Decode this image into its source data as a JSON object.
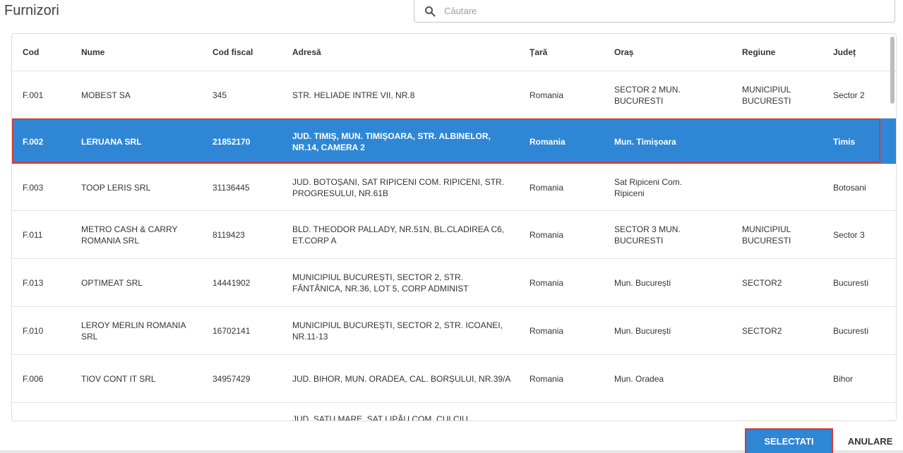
{
  "title": "Furnizori",
  "search": {
    "placeholder": "Căutare",
    "icon": "search-icon"
  },
  "columns": [
    "Cod",
    "Nume",
    "Cod fiscal",
    "Adresă",
    "Țară",
    "Oraș",
    "Regiune",
    "Județ"
  ],
  "rows": [
    {
      "cod": "F.001",
      "nume": "MOBEST SA",
      "cod_fiscal": "345",
      "adresa": "STR. HELIADE INTRE VII, NR.8",
      "tara": "Romania",
      "oras": "SECTOR 2 MUN. BUCURESTI",
      "regiune": "MUNICIPIUL BUCURESTI",
      "judet": "Sector 2",
      "selected": false
    },
    {
      "cod": "F.002",
      "nume": "LERUANA SRL",
      "cod_fiscal": "21852170",
      "adresa": "JUD. TIMIȘ, MUN. TIMIȘOARA, STR. ALBINELOR, NR.14, CAMERA 2",
      "tara": "Romania",
      "oras": "Mun. Timișoara",
      "regiune": "",
      "judet": "Timis",
      "selected": true
    },
    {
      "cod": "F.003",
      "nume": "TOOP LERIS SRL",
      "cod_fiscal": "31136445",
      "adresa": "JUD. BOTOȘANI, SAT RIPICENI COM. RIPICENI, STR. PROGRESULUI, NR.61B",
      "tara": "Romania",
      "oras": "Sat Ripiceni Com. Ripiceni",
      "regiune": "",
      "judet": "Botosani",
      "selected": false
    },
    {
      "cod": "F.011",
      "nume": "METRO CASH & CARRY ROMANIA SRL",
      "cod_fiscal": "8119423",
      "adresa": "BLD. THEODOR PALLADY, NR.51N, BL.CLADIREA C6, ET.CORP A",
      "tara": "Romania",
      "oras": "SECTOR 3 MUN. BUCURESTI",
      "regiune": "MUNICIPIUL BUCURESTI",
      "judet": "Sector 3",
      "selected": false
    },
    {
      "cod": "F.013",
      "nume": "OPTIMEAT SRL",
      "cod_fiscal": "14441902",
      "adresa": "MUNICIPIUL BUCUREȘTI, SECTOR 2, STR. FÂNTÂNICA, NR.36, LOT 5, CORP ADMINIST",
      "tara": "Romania",
      "oras": "Mun. București",
      "regiune": "SECTOR2",
      "judet": "Bucuresti",
      "selected": false
    },
    {
      "cod": "F.010",
      "nume": "LEROY MERLIN ROMANIA SRL",
      "cod_fiscal": "16702141",
      "adresa": "MUNICIPIUL BUCUREȘTI, SECTOR 2, STR. ICOANEI, NR.11-13",
      "tara": "Romania",
      "oras": "Mun. București",
      "regiune": "SECTOR2",
      "judet": "Bucuresti",
      "selected": false
    },
    {
      "cod": "F.006",
      "nume": "TIOV CONT IT SRL",
      "cod_fiscal": "34957429",
      "adresa": "JUD. BIHOR, MUN. ORADEA, CAL. BORȘULUI, NR.39/A",
      "tara": "Romania",
      "oras": "Mun. Oradea",
      "regiune": "",
      "judet": "Bihor",
      "selected": false
    },
    {
      "cod": "",
      "nume": "",
      "cod_fiscal": "",
      "adresa": "JUD. SATU MARE, SAT LIPĂU COM. CULCIU,",
      "tara": "",
      "oras": "",
      "regiune": "",
      "judet": "",
      "selected": false
    }
  ],
  "buttons": {
    "select": "SELECTATI",
    "cancel": "ANULARE"
  },
  "colors": {
    "accent": "#2f86d4",
    "highlight_border": "#d43a3a"
  }
}
